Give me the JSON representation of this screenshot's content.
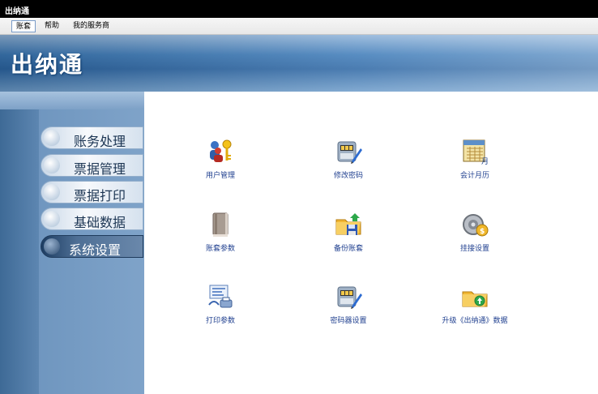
{
  "window": {
    "title": "出纳通"
  },
  "menu": [
    {
      "label": "账套"
    },
    {
      "label": "帮助"
    },
    {
      "label": "我的服务商"
    }
  ],
  "header": {
    "brand": "出纳通"
  },
  "sidebar": {
    "active_index": 4,
    "items": [
      {
        "label": "账务处理"
      },
      {
        "label": "票据管理"
      },
      {
        "label": "票据打印"
      },
      {
        "label": "基础数据"
      },
      {
        "label": "系统设置"
      }
    ]
  },
  "main": {
    "tiles": [
      {
        "label": "用户管理",
        "icon": "users-keys-icon"
      },
      {
        "label": "修改密码",
        "icon": "change-password-icon"
      },
      {
        "label": "会计月历",
        "icon": "calendar-icon"
      },
      {
        "label": "账套参数",
        "icon": "ledger-book-icon"
      },
      {
        "label": "备份账套",
        "icon": "backup-folder-icon"
      },
      {
        "label": "挂接设置",
        "icon": "link-settings-icon"
      },
      {
        "label": "打印参数",
        "icon": "print-settings-icon"
      },
      {
        "label": "密码器设置",
        "icon": "cipher-device-icon"
      },
      {
        "label": "升级《出纳通》数据",
        "icon": "upgrade-data-icon"
      }
    ]
  }
}
